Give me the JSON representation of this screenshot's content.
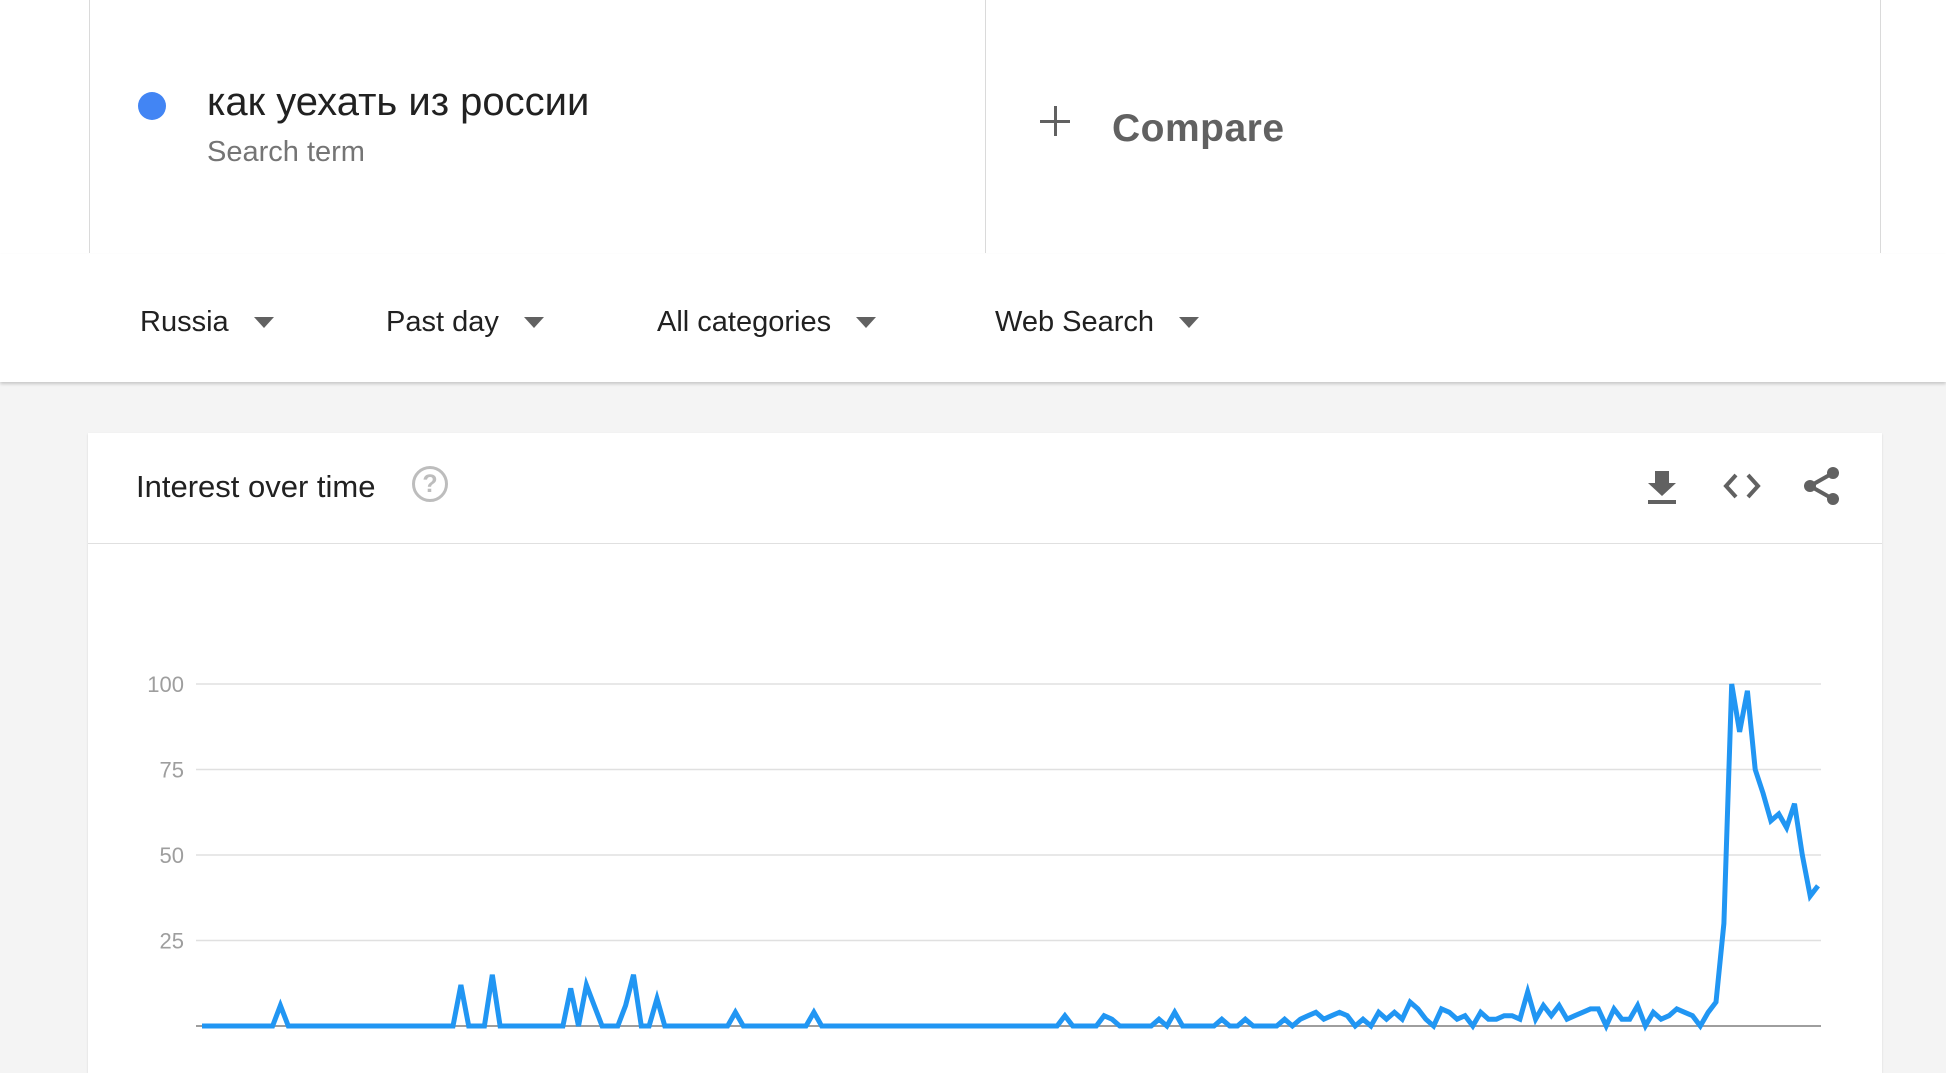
{
  "search_term": {
    "title": "как уехать из россии",
    "subtitle": "Search term",
    "color": "#4285f4"
  },
  "compare": {
    "label": "Compare",
    "icon": "plus-icon"
  },
  "filters": {
    "region": "Russia",
    "time": "Past day",
    "category": "All categories",
    "property": "Web Search"
  },
  "card": {
    "title": "Interest over time",
    "icons": [
      "help-icon",
      "download-icon",
      "embed-icon",
      "share-icon"
    ]
  },
  "chart_data": {
    "type": "line",
    "title": "",
    "xlabel": "",
    "ylabel": "",
    "ylim": [
      0,
      100
    ],
    "yticks": [
      25,
      50,
      75,
      100
    ],
    "grid": true,
    "line_color": "#2196f3",
    "series": [
      {
        "values": [
          0,
          0,
          0,
          0,
          0,
          0,
          0,
          0,
          0,
          0,
          6,
          0,
          0,
          0,
          0,
          0,
          0,
          0,
          0,
          0,
          0,
          0,
          0,
          0,
          0,
          0,
          0,
          0,
          0,
          0,
          0,
          0,
          0,
          12,
          0,
          0,
          0,
          15,
          0,
          0,
          0,
          0,
          0,
          0,
          0,
          0,
          0,
          11,
          0,
          12,
          6,
          0,
          0,
          0,
          6,
          15,
          0,
          0,
          8,
          0,
          0,
          0,
          0,
          0,
          0,
          0,
          0,
          0,
          4,
          0,
          0,
          0,
          0,
          0,
          0,
          0,
          0,
          0,
          4,
          0,
          0,
          0,
          0,
          0,
          0,
          0,
          0,
          0,
          0,
          0,
          0,
          0,
          0,
          0,
          0,
          0,
          0,
          0,
          0,
          0,
          0,
          0,
          0,
          0,
          0,
          0,
          0,
          0,
          0,
          0,
          3,
          0,
          0,
          0,
          0,
          3,
          2,
          0,
          0,
          0,
          0,
          0,
          2,
          0,
          4,
          0,
          0,
          0,
          0,
          0,
          2,
          0,
          0,
          2,
          0,
          0,
          0,
          0,
          2,
          0,
          2,
          3,
          4,
          2,
          3,
          4,
          3,
          0,
          2,
          0,
          4,
          2,
          4,
          2,
          7,
          5,
          2,
          0,
          5,
          4,
          2,
          3,
          0,
          4,
          2,
          2,
          3,
          3,
          2,
          10,
          2,
          6,
          3,
          6,
          2,
          3,
          4,
          5,
          5,
          0,
          5,
          2,
          2,
          6,
          0,
          4,
          2,
          3,
          5,
          4,
          3,
          0,
          4,
          7,
          30,
          100,
          86,
          98,
          75,
          68,
          60,
          62,
          58,
          65,
          50,
          38,
          41
        ]
      }
    ]
  }
}
